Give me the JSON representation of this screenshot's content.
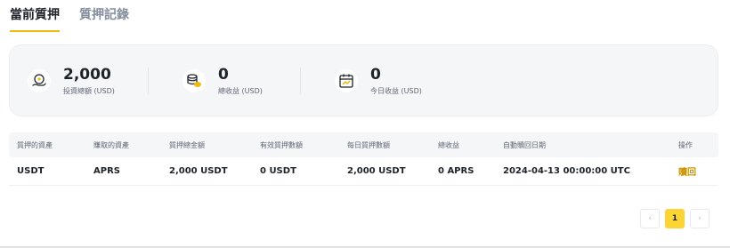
{
  "tabs": [
    {
      "label": "當前質押",
      "active": true
    },
    {
      "label": "質押記錄",
      "active": false
    }
  ],
  "summary": [
    {
      "icon": "coin-hand-icon",
      "value": "2,000",
      "label": "投資總額 (USD)"
    },
    {
      "icon": "coin-stack-icon",
      "value": "0",
      "label": "總收益 (USD)"
    },
    {
      "icon": "calendar-icon",
      "value": "0",
      "label": "今日收益 (USD)"
    }
  ],
  "table": {
    "headers": [
      "質押的資產",
      "賺取的資產",
      "質押總金額",
      "有效質押數額",
      "每日質押數額",
      "總收益",
      "自動贖回日期",
      "操作"
    ],
    "rows": [
      [
        "USDT",
        "APRS",
        "2,000 USDT",
        "0 USDT",
        "2,000 USDT",
        "0 APRS",
        "2024-04-13 00:00:00 UTC",
        "贖回"
      ]
    ]
  },
  "pagination": {
    "prev": "‹",
    "current": "1",
    "next": "›"
  },
  "colors": {
    "accent": "#f0b90b",
    "link": "#c99400"
  }
}
